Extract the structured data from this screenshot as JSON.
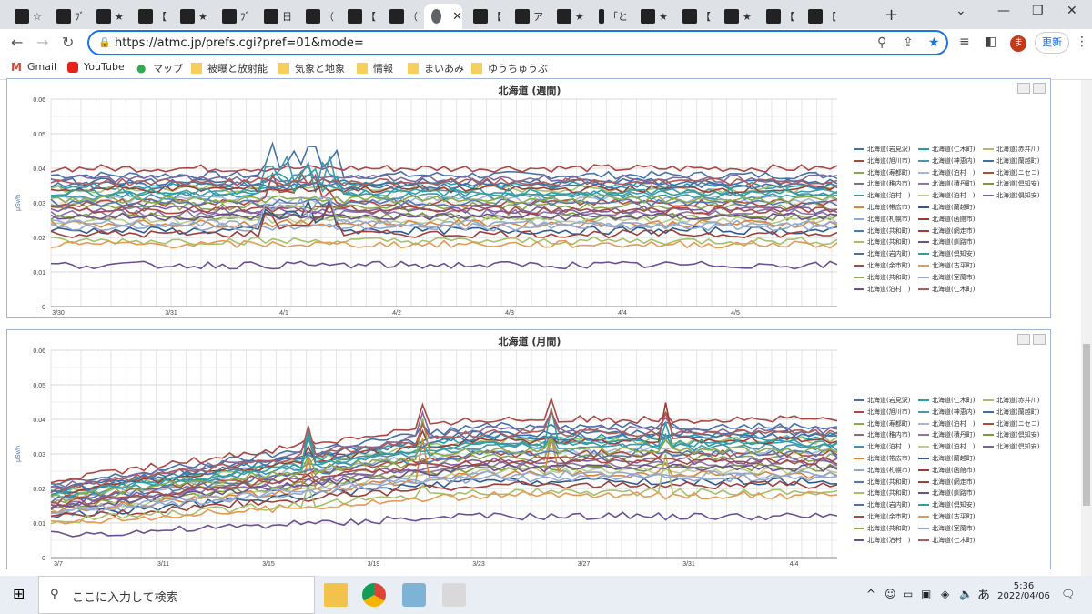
{
  "tabs": [
    {
      "label": "☆"
    },
    {
      "label": "ﾌﾞ"
    },
    {
      "label": "★"
    },
    {
      "label": "【"
    },
    {
      "label": "★"
    },
    {
      "label": "ﾌﾞ"
    },
    {
      "label": "日"
    },
    {
      "label": "（"
    },
    {
      "label": "【"
    },
    {
      "label": "（"
    },
    {
      "label": ""
    },
    {
      "label": "【"
    },
    {
      "label": "ア"
    },
    {
      "label": "★"
    },
    {
      "label": "「と"
    },
    {
      "label": "★"
    },
    {
      "label": "【"
    },
    {
      "label": "★"
    },
    {
      "label": "【"
    },
    {
      "label": "【"
    }
  ],
  "address": {
    "url": "https://atmc.jp/prefs.cgi?pref=01&mode="
  },
  "profile": {
    "initial": "ま"
  },
  "update_label": "更新",
  "bookmarks": [
    {
      "label": "Gmail"
    },
    {
      "label": "YouTube"
    },
    {
      "label": "マップ"
    },
    {
      "label": "被曝と放射能"
    },
    {
      "label": "気象と地象"
    },
    {
      "label": "情報"
    },
    {
      "label": "まいあみ"
    },
    {
      "label": "ゆうちゅうぶ"
    }
  ],
  "charts": [
    {
      "title": "北海道 (週間)",
      "ylabel": "μSv/h",
      "yticks": [
        "0.06",
        "0.05",
        "0.04",
        "0.03",
        "0.02",
        "0.01",
        "0"
      ],
      "xticks": [
        "3/30",
        "3/31",
        "4/1",
        "4/2",
        "4/3",
        "4/4",
        "4/5"
      ]
    },
    {
      "title": "北海道 (月間)",
      "ylabel": "μSv/h",
      "yticks": [
        "0.06",
        "0.05",
        "0.04",
        "0.03",
        "0.02",
        "0.01",
        "0"
      ],
      "xticks": [
        "3/7",
        "3/11",
        "3/15",
        "3/19",
        "3/23",
        "3/27",
        "3/31",
        "4/4"
      ]
    }
  ],
  "legend": [
    {
      "label": "北海道(岩見沢)",
      "color": "#4572a7"
    },
    {
      "label": "北海道(仁木町)",
      "color": "#23a0b0"
    },
    {
      "label": "北海道(赤井川)",
      "color": "#a5c06a"
    },
    {
      "label": "北海道(旭川市)",
      "color": "#aa4643"
    },
    {
      "label": "北海道(神恵内)",
      "color": "#4198af"
    },
    {
      "label": "北海道(蘭越町)",
      "color": "#3d6fa6"
    },
    {
      "label": "北海道(寿都町)",
      "color": "#89a54e"
    },
    {
      "label": "北海道(泊村　)",
      "color": "#a4b6d8"
    },
    {
      "label": "北海道(ニセコ)",
      "color": "#b04a3f"
    },
    {
      "label": "北海道(稚内市)",
      "color": "#80699b"
    },
    {
      "label": "北海道(積丹町)",
      "color": "#8c76a8"
    },
    {
      "label": "北海道(倶知安)",
      "color": "#7a9a3c"
    },
    {
      "label": "北海道(泊村　)",
      "color": "#3d96ae"
    },
    {
      "label": "北海道(泊村　)",
      "color": "#b8cd8e"
    },
    {
      "label": "北海道(倶知安)",
      "color": "#7e5fa3"
    },
    {
      "label": "北海道(帯広市)",
      "color": "#db843d"
    },
    {
      "label": "北海道(蘭越町)",
      "color": "#2f5b8c"
    },
    {
      "label": "北海道(札幌市)",
      "color": "#92a8cd"
    },
    {
      "label": "北海道(函館市)",
      "color": "#a03a37"
    },
    {
      "label": "北海道(共和町)",
      "color": "#5479b0"
    },
    {
      "label": "北海道(網走市)",
      "color": "#9e3f3a"
    },
    {
      "label": "北海道(共和町)",
      "color": "#a5c06a"
    },
    {
      "label": "北海道(釧路市)",
      "color": "#6b5189"
    },
    {
      "label": "北海道(岩内町)",
      "color": "#4a74a8"
    },
    {
      "label": "北海道(倶知安)",
      "color": "#2fa0a0"
    },
    {
      "label": "北海道(余市町)",
      "color": "#a64a46"
    },
    {
      "label": "北海道(古平町)",
      "color": "#e59a52"
    },
    {
      "label": "北海道(共和町)",
      "color": "#8aab46"
    },
    {
      "label": "北海道(室蘭市)",
      "color": "#94aad0"
    },
    {
      "label": "北海道(泊村　)",
      "color": "#6c4f93"
    },
    {
      "label": "北海道(仁木町)",
      "color": "#b05b58"
    }
  ],
  "taskbar": {
    "search_placeholder": "ここに入力して検索",
    "time": "5:36",
    "date": "2022/04/06",
    "ime": "あ"
  }
}
